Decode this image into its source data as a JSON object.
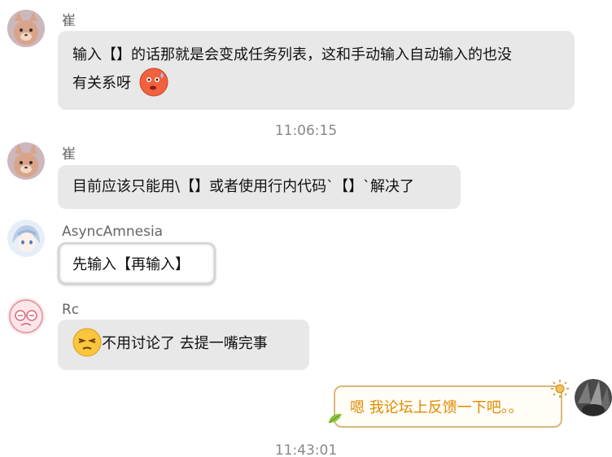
{
  "messages": [
    {
      "sender": "崔",
      "line1": "输入【】的话那就是会变成任务列表，这和手动输入自动输入的也没",
      "line2": "有关系呀"
    },
    {
      "sender": "崔",
      "text": "目前应该只能用\\【】或者使用行内代码`【】`解决了"
    },
    {
      "sender": "AsyncAmnesia",
      "text": "先输入【再输入】"
    },
    {
      "sender": "Rc",
      "text": "不用讨论了  去提一嘴完事"
    },
    {
      "sender": "",
      "text": "嗯 我论坛上反馈一下吧。。"
    }
  ],
  "timestamps": [
    "11:06:15",
    "11:43:01"
  ],
  "icons": {
    "avatar_cui": "cat-avatar-icon",
    "avatar_async": "anime-girl-avatar-icon",
    "avatar_rc": "crying-face-avatar-icon",
    "avatar_self": "dark-anime-avatar-icon",
    "emoji_sweat": "sweating-face-emoji-icon",
    "emoji_squint": "squinting-face-emoji-icon"
  },
  "colors": {
    "bubble_gray": "#e8e8e8",
    "self_text": "#e08a00",
    "self_border": "#d9b77a"
  }
}
